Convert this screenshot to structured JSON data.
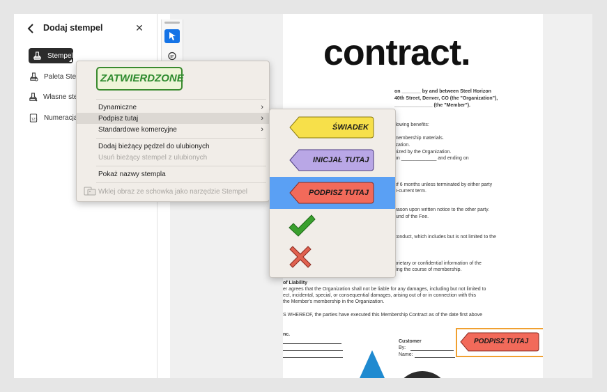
{
  "panel": {
    "title": "Dodaj stempel",
    "tools": [
      {
        "label": "Stempel"
      },
      {
        "label": "Paleta Stempli"
      },
      {
        "label": "Własne stempele"
      },
      {
        "label": "Numeracja"
      }
    ]
  },
  "document": {
    "title": "contract.",
    "lines": [
      "on _______ by and between Steel Horizon",
      "40th Street, Denver, CO (the \"Organization\"),",
      "______________ (the \"Member\").",
      "llowing benefits:",
      "membership materials.",
      "ization.",
      "nized by the Organization.",
      "on _____________ and ending on",
      "of 6 months unless terminated by either party",
      "n-current term.",
      "eason upon written notice to the other party.",
      "fund of the Fee.",
      "conduct, which includes but is not limited to the",
      "prietary or confidential information of the",
      "ring the course of membership.",
      "of Liability",
      "er agrees that the Organization shall not be liable for any damages, including but not limited to",
      "ect, incidental, special, or consequential damages, arising out of or in connection with this",
      "the Member's membership in the Organization.",
      "S WHEREOF, the parties have executed this Membership Contract as of the date first above",
      "nc.",
      "Customer",
      "By:",
      "Name:"
    ],
    "placed_stamp_label": "PODPISZ TUTAJ"
  },
  "context_menu": {
    "preview_stamp": "ZATWIERDZONE",
    "items": [
      {
        "label": "Dynamiczne",
        "submenu": true
      },
      {
        "label": "Podpisz tutaj",
        "submenu": true
      },
      {
        "label": "Standardowe komercyjne",
        "submenu": true
      },
      {
        "label": "Dodaj bieżący pędzel do ulubionych"
      },
      {
        "label": "Usuń bieżący stempel z ulubionych"
      },
      {
        "label": "Pokaż nazwy stempla"
      },
      {
        "label": "Wklej obraz ze schowka jako narzędzie Stempel"
      }
    ],
    "chevron": "›"
  },
  "submenu": {
    "stamps": [
      {
        "label": "ŚWIADEK",
        "color": "#f7e04a"
      },
      {
        "label": "INICJAŁ TUTAJ",
        "color": "#b9a7e6"
      },
      {
        "label": "PODPISZ TUTAJ",
        "color": "#f26a5a"
      }
    ]
  },
  "colors": {
    "accent": "#1473e6",
    "submenu_selected": "#5aa0f4",
    "approved_green": "#2e8b2e",
    "placed_stamp_border": "#f0a030"
  }
}
